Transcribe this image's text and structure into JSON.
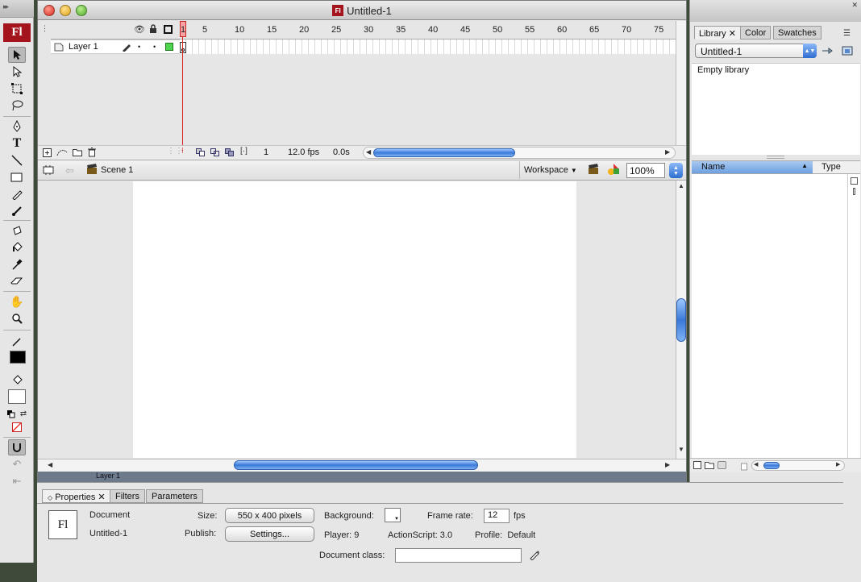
{
  "toolbar": {
    "logo": "Fl",
    "tools": [
      "selection-tool",
      "subselection-tool",
      "free-transform-tool",
      "lasso-tool",
      "pen-tool",
      "text-tool",
      "line-tool",
      "rectangle-tool",
      "pencil-tool",
      "brush-tool",
      "ink-bottle-tool",
      "paint-bucket-tool",
      "eyedropper-tool",
      "eraser-tool",
      "hand-tool",
      "zoom-tool"
    ],
    "text_tool_glyph": "T"
  },
  "window": {
    "title": "Untitled-1",
    "title_icon": "Fl"
  },
  "timeline": {
    "ruler": [
      "1",
      "5",
      "10",
      "15",
      "20",
      "25",
      "30",
      "35",
      "40",
      "45",
      "50",
      "55",
      "60",
      "65",
      "70",
      "75"
    ],
    "layer_name": "Layer 1",
    "current_frame": "1",
    "frame_rate": "12.0 fps",
    "elapsed": "0.0s"
  },
  "editbar": {
    "scene": "Scene 1",
    "workspace": "Workspace",
    "zoom": "100%"
  },
  "library": {
    "tabs": [
      "Library",
      "Color",
      "Swatches"
    ],
    "document": "Untitled-1",
    "empty_text": "Empty library",
    "col_name": "Name",
    "col_type": "Type"
  },
  "background_window": {
    "layer_name": "Layer 1"
  },
  "properties": {
    "tabs": [
      "Properties",
      "Filters",
      "Parameters"
    ],
    "logo": "Fl",
    "kind": "Document",
    "doc_name": "Untitled-1",
    "size_label": "Size:",
    "size_value": "550 x 400 pixels",
    "publish_label": "Publish:",
    "settings_button": "Settings...",
    "background_label": "Background:",
    "framerate_label": "Frame rate:",
    "framerate_value": "12",
    "fps_label": "fps",
    "player": "Player: 9",
    "actionscript": "ActionScript: 3.0",
    "profile": "Profile:  Default",
    "docclass_label": "Document class:",
    "docclass_value": ""
  },
  "colors": {
    "accent": "#3a79d8",
    "flash_red": "#a3141d",
    "playhead": "#dd2222"
  }
}
